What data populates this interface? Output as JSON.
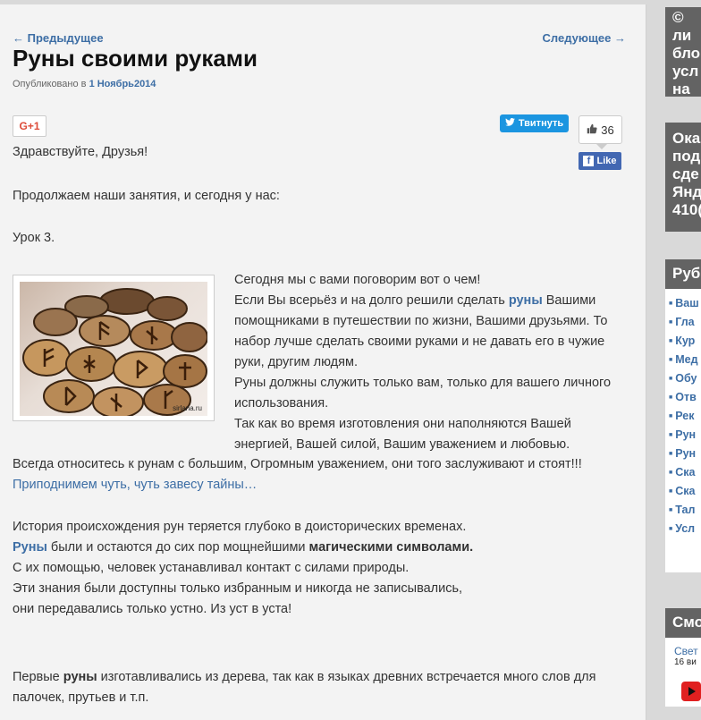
{
  "nav": {
    "prev": "← Предыдущее",
    "next": "Следующее →"
  },
  "post": {
    "title": "Руны своими руками",
    "published_prefix": "Опубликовано в",
    "published_date": "1 Ноябрь2014"
  },
  "share": {
    "gplus": "G+1",
    "tweet": "Твитнуть",
    "fb_count": "36",
    "fb_like": "Like"
  },
  "content": {
    "greeting": "Здравствуйте, Друзья!",
    "intro": "Продолжаем наши занятия, и сегодня у нас:",
    "lesson": "Урок 3.",
    "image_watermark": "sirlana.ru",
    "side_p1": "Сегодня мы с вами поговорим вот о чем!",
    "side_p2_a": "Если Вы всерьёз и на долго решили сделать ",
    "side_p2_link": "руны",
    "side_p2_b": " Вашими помощниками в путешествии по жизни, Вашими друзьями. То набор лучше сделать своими руками и не давать его в чужие руки, другим людям.",
    "side_p3": "Руны  должны служить только вам, только для вашего личного использования.",
    "side_p4": "Так как во время изготовления они наполняются Вашей энергией, Вашей силой, Вашим уважением и любовью.",
    "respect": "Всегда относитесь к рунам с большим, Огромным  уважением, они того заслуживают и стоят!!!",
    "more_link": "Приподнимем чуть, чуть  завесу тайны…",
    "h1": "История происхождения рун теряется глубоко в доисторических временах.",
    "h2_link": "Руны",
    "h2_a": " были  и остаются до сих пор  мощнейшими ",
    "h2_bold": "магическими символами.",
    "h3": "С их помощью, человек устанавливал  контакт с силами природы.",
    "h4": "Эти знания были доступны только избранным и никогда не записывались,",
    "h5": "они передавались только устно. Из уст в уста!",
    "f1_a": "Первые ",
    "f1_bold": "руны",
    "f1_b": " изготавливались из дерева, так как в языках древних встречается много слов для палочек, прутьев и т.п."
  },
  "sidebar": {
    "box1": [
      "© ли",
      "бло",
      "усл",
      "на з"
    ],
    "box2": [
      "Ока",
      "под",
      "сде",
      "Янд",
      "410("
    ],
    "rubrics_title": "Рубр",
    "rubrics": [
      "Ваш",
      "Гла",
      "Кур",
      "Мед",
      "Обу",
      "Отв",
      "Рек",
      "Рун",
      "Рун",
      "Ска",
      "Ска",
      "Тал",
      "Усл"
    ],
    "watch_title": "Смо",
    "watch_item": "Свет",
    "watch_sub": "16 ви"
  },
  "colors": {
    "link": "#3d6ea5",
    "sidebar_dark": "#636363",
    "twitter": "#1b95e0",
    "facebook": "#4267b2"
  }
}
